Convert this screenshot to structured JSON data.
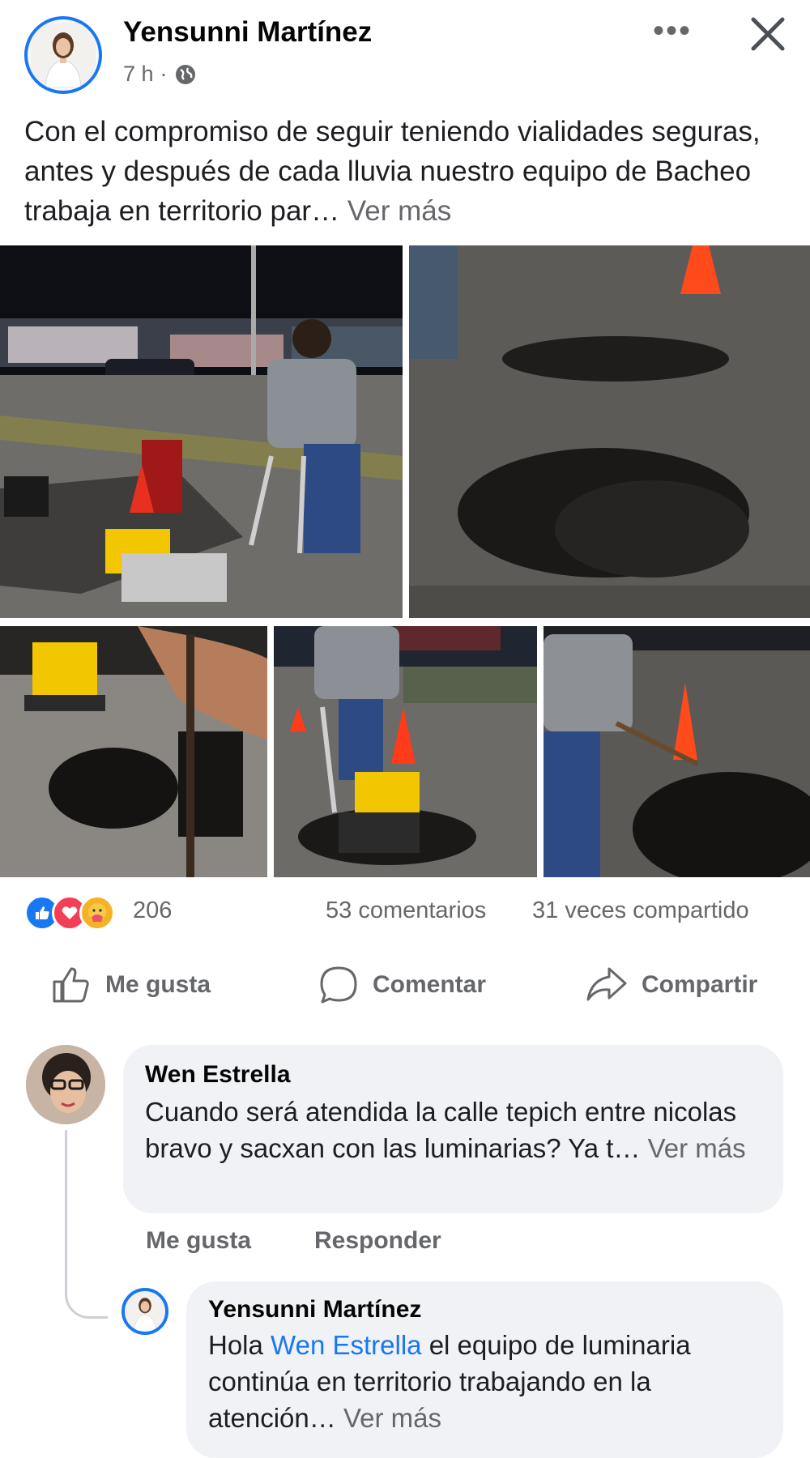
{
  "post": {
    "author": "Yensunni Martínez",
    "time": "7 h",
    "separator": "·",
    "text": "Con el compromiso de seguir teniendo vialidades seguras, antes y después de cada lluvia nuestro equipo de Bacheo trabaja en territorio par…",
    "see_more": "Ver más"
  },
  "stats": {
    "reaction_count": "206",
    "comments": "53 comentarios",
    "shares": "31 veces compartido"
  },
  "actions": {
    "like": "Me gusta",
    "comment": "Comentar",
    "share": "Compartir"
  },
  "comments": [
    {
      "author": "Wen Estrella",
      "text": "Cuando será atendida la calle tepich entre nicolas bravo y sacxan con las luminarias? Ya t…",
      "see_more": "Ver más",
      "like": "Me gusta",
      "reply": "Responder"
    }
  ],
  "reply": {
    "author": "Yensunni Martínez",
    "greeting": "Hola",
    "mention": "Wen Estrella",
    "text": "el equipo de luminaria continúa en territorio trabajando en la atención…",
    "see_more": "Ver más"
  },
  "colors": {
    "accent": "#1877f2",
    "muted": "#65676b",
    "bubble": "#f0f2f5",
    "cone": "#ff4a1c",
    "compactor": "#f2c600"
  },
  "icons": {
    "globe": "globe-icon",
    "more": "more-options-icon",
    "close": "close-icon",
    "like_reaction": "like-reaction-icon",
    "love_reaction": "love-reaction-icon",
    "care_reaction": "care-reaction-icon",
    "thumbs_up": "thumbs-up-icon",
    "comment": "comment-bubble-icon",
    "share": "share-arrow-icon"
  }
}
